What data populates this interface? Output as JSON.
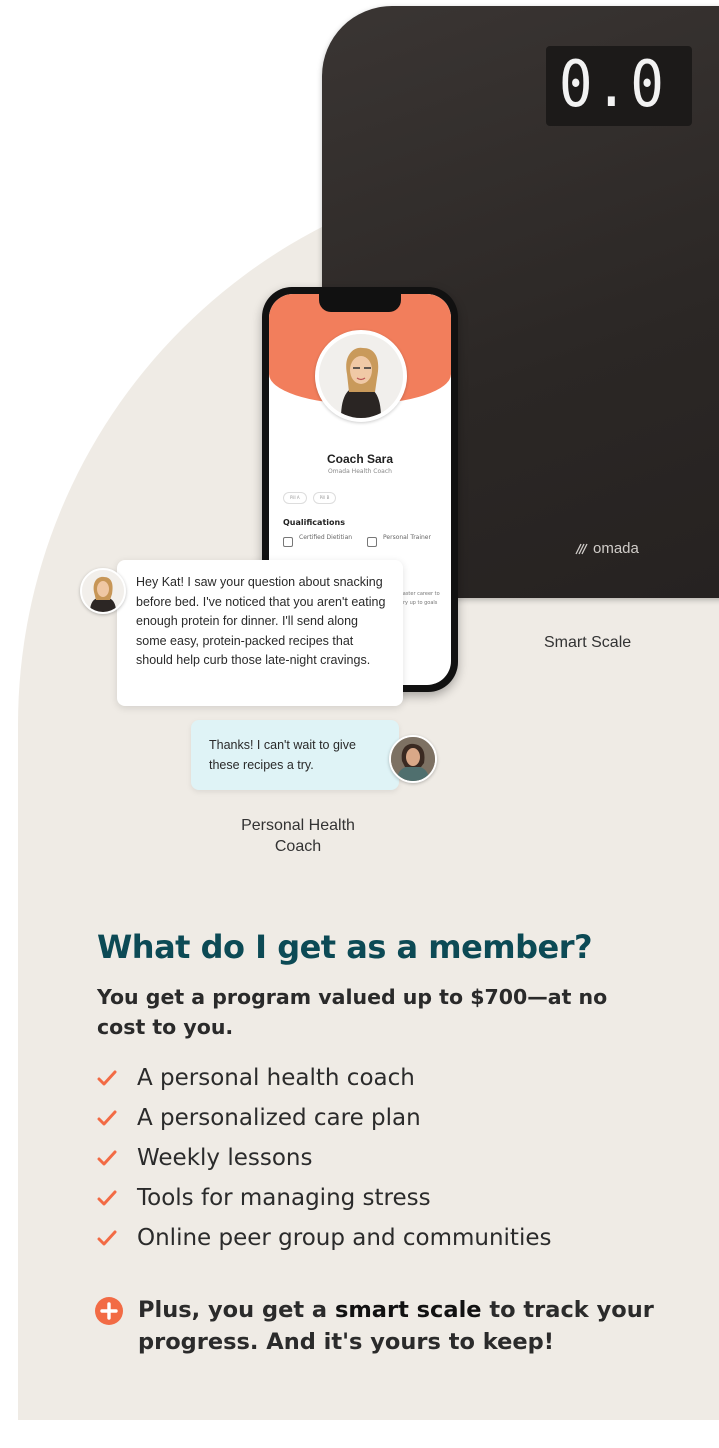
{
  "scale": {
    "readout": "0.0",
    "brand": "omada",
    "caption": "Smart Scale"
  },
  "phone": {
    "coach_name": "Coach Sara",
    "coach_role": "Omada Health Coach",
    "pills": [
      "Pill A",
      "Pill B"
    ],
    "qualifications_title": "Qualifications",
    "qualifications": [
      "Certified Dietitian",
      "Personal Trainer"
    ],
    "tail_text": "faster career to try up to goals"
  },
  "chat": {
    "coach_message": "Hey Kat! I saw your question about snacking before bed. I've noticed that you aren't eating enough protein for dinner. I'll send along some easy, protein-packed recipes that should help curb those late-night cravings.",
    "member_message": "Thanks! I can't wait to give these recipes a try.",
    "caption": "Personal Health Coach"
  },
  "content": {
    "heading": "What do I get as a member?",
    "subheading": "You get a program valued up to $700—at no cost to you.",
    "benefits": [
      "A personal health coach",
      "A personalized care plan",
      "Weekly lessons",
      "Tools for managing stress",
      "Online peer group and communities"
    ],
    "plus_prefix": "Plus, you get a ",
    "plus_bold": "smart scale",
    "plus_suffix": " to track your progress. And it's yours to keep!"
  },
  "colors": {
    "accent": "#f26b45",
    "heading": "#0c4a55",
    "background": "#efebe5",
    "member_bubble": "#dff3f6"
  }
}
